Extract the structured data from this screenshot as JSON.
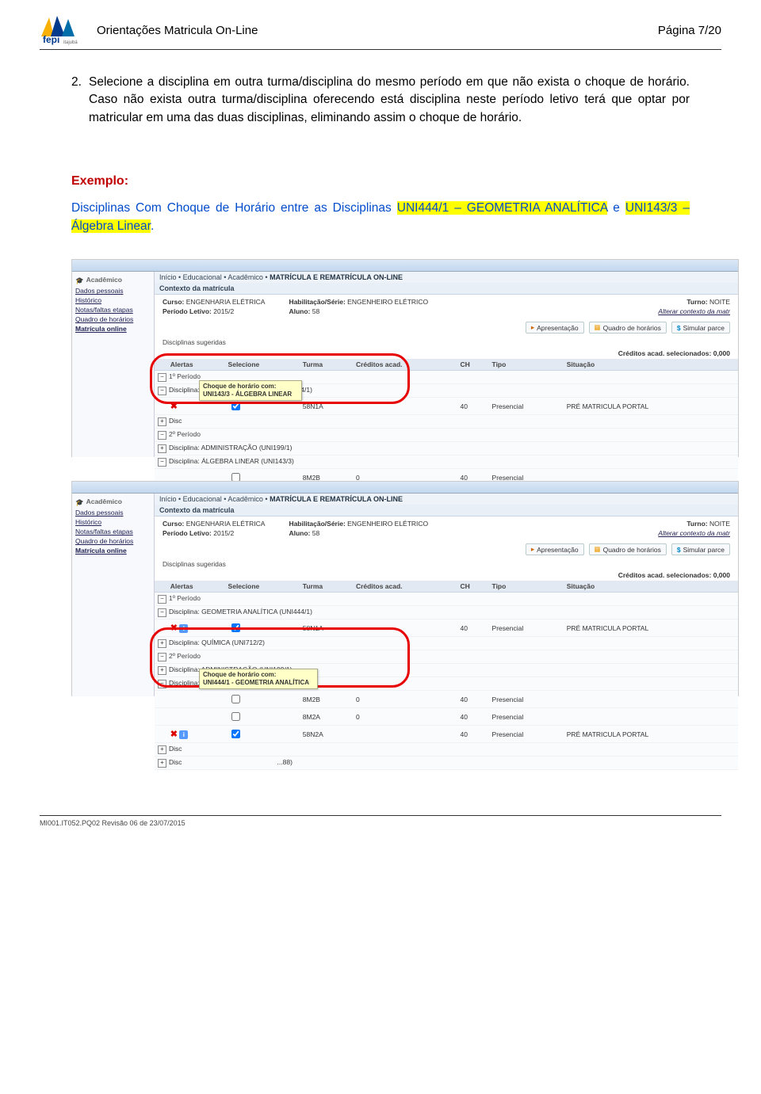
{
  "header": {
    "title": "Orientações Matricula On-Line",
    "page": "Página 7/20"
  },
  "logo_text": "fepi",
  "logo_sub": "itajubá",
  "body": {
    "item_num": "2.",
    "item_text": "Selecione a disciplina em outra turma/disciplina do mesmo período em que não exista o choque de horário. Caso não exista outra turma/disciplina oferecendo está disciplina neste período letivo terá que optar por matricular em uma das duas disciplinas, eliminando assim o choque de horário.",
    "exemplo": "Exemplo:",
    "blue1": "Disciplinas Com Choque de Horário entre as Disciplinas ",
    "hl1": "UNI444/1 – GEOMETRIA ANALÍTICA",
    "blue2": " e ",
    "hl2": "UNI143/3 – Álgebra Linear",
    "blue3": "."
  },
  "shot": {
    "breadcrumb": [
      "Início",
      "Educacional",
      "Acadêmico",
      "MATRÍCULA E REMATRÍCULA ON-LINE"
    ],
    "sidebar_title": "Acadêmico",
    "sidebar_items": [
      "Dados pessoais",
      "Histórico",
      "Notas/faltas etapas",
      "Quadro de horários",
      "Matrícula online"
    ],
    "ctx_title": "Contexto da matrícula",
    "curso_lbl": "Curso:",
    "curso_val": "ENGENHARIA ELÉTRICA",
    "periodo_lbl": "Período Letivo:",
    "periodo_val": "2015/2",
    "hab_lbl": "Habilitação/Série:",
    "hab_val": "ENGENHEIRO ELÉTRICO",
    "aluno_lbl": "Aluno:",
    "aluno_val": "58",
    "turno_lbl": "Turno:",
    "turno_val": "NOITE",
    "alterar": "Alterar contexto da matr",
    "btn1": "Apresentação",
    "btn2": "Quadro de horários",
    "btn3": "Simular parce",
    "disc_sug": "Disciplinas sugeridas",
    "credits": "Créditos acad. selecionados: 0,000",
    "cols": {
      "alertas": "Alertas",
      "selecione": "Selecione",
      "turma": "Turma",
      "cred": "Créditos acad.",
      "ch": "CH",
      "tipo": "Tipo",
      "sit": "Situação"
    },
    "p1": "1º Período",
    "p2": "2º Período",
    "d_geo": "Disciplina: GEOMETRIA ANALÍTICA (UNI444/1)",
    "d_qui": "Disciplina: QUÍMICA (UNI712/2)",
    "d_adm": "Disciplina: ADMINISTRAÇÃO (UNI199/1)",
    "d_alg": "Disciplina: ÁLGEBRA LINEAR (UNI143/3)",
    "t_58n1a": "58N1A",
    "t_8m2b": "8M2B",
    "t_8m2a": "8M2A",
    "t_58n2a": "58N2A",
    "ch40": "40",
    "cred0": "0",
    "presencial": "Presencial",
    "pre_mat": "PRÉ MATRICULA PORTAL",
    "tool_label": "Choque de horário com:",
    "tool1_b": "UNI143/3 - ÁLGEBRA LINEAR",
    "tool2_b": "UNI444/1 - GEOMETRIA ANALÍTICA",
    "d_disc_tail": "...88)"
  },
  "footer": "MI001.IT052.PQ02   Revisão 06 de  23/07/2015"
}
